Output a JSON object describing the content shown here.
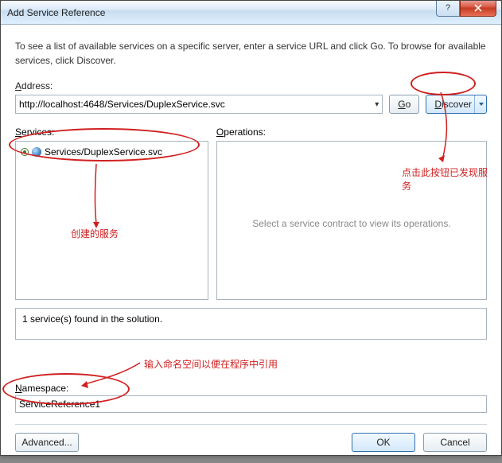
{
  "window": {
    "title": "Add Service Reference"
  },
  "instructions": "To see a list of available services on a specific server, enter a service URL and click Go. To browse for available services, click Discover.",
  "labels": {
    "address_prefix": "A",
    "address_rest": "ddress:",
    "services_prefix": "S",
    "services_rest": "ervices:",
    "operations_prefix": "O",
    "operations_rest": "perations:",
    "namespace_prefix": "N",
    "namespace_rest": "amespace:"
  },
  "address": {
    "value": "http://localhost:4648/Services/DuplexService.svc"
  },
  "buttons": {
    "go_prefix": "G",
    "go_rest": "o",
    "discover_prefix": "D",
    "discover_rest": "iscover",
    "advanced": "Advanced...",
    "ok": "OK",
    "cancel": "Cancel"
  },
  "services": {
    "items": [
      {
        "label": "Services/DuplexService.svc"
      }
    ]
  },
  "operations": {
    "placeholder": "Select a service contract to view its operations."
  },
  "status": {
    "text": "1 service(s) found in the solution."
  },
  "namespace": {
    "value": "ServiceReference1"
  },
  "annotations": {
    "discover_note": "点击此按钮已发现服务",
    "service_note": "创建的服务",
    "namespace_note": "输入命名空间以便在程序中引用"
  }
}
